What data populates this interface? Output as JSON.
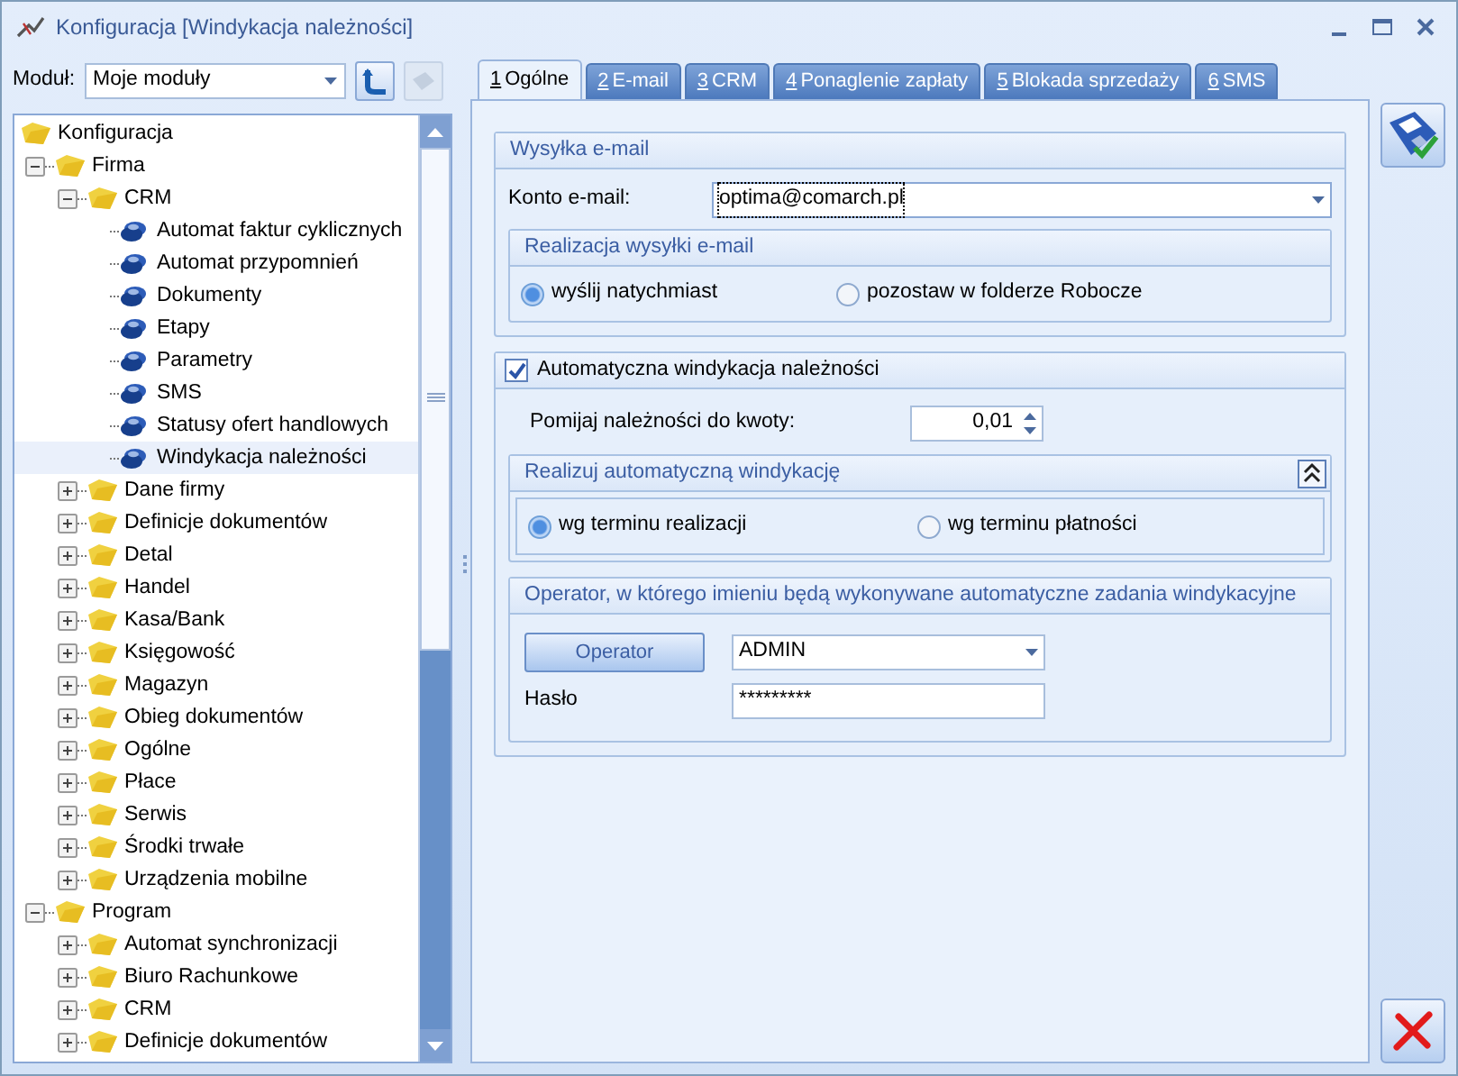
{
  "window": {
    "title": "Konfiguracja [Windykacja należności]"
  },
  "module": {
    "label": "Moduł:",
    "value": "Moje moduły"
  },
  "tree": [
    {
      "label": "Konfiguracja",
      "kind": "folder",
      "selected": false,
      "children": [
        {
          "label": "Firma",
          "kind": "folder",
          "selected": false,
          "expanded": true,
          "children": [
            {
              "label": "CRM",
              "kind": "folder",
              "selected": false,
              "expanded": true,
              "children": [
                {
                  "label": "Automat faktur cyklicznych",
                  "kind": "leaf",
                  "selected": false
                },
                {
                  "label": "Automat przypomnień",
                  "kind": "leaf",
                  "selected": false
                },
                {
                  "label": "Dokumenty",
                  "kind": "leaf",
                  "selected": false
                },
                {
                  "label": "Etapy",
                  "kind": "leaf",
                  "selected": false
                },
                {
                  "label": "Parametry",
                  "kind": "leaf",
                  "selected": false
                },
                {
                  "label": "SMS",
                  "kind": "leaf",
                  "selected": false
                },
                {
                  "label": "Statusy ofert handlowych",
                  "kind": "leaf",
                  "selected": false
                },
                {
                  "label": "Windykacja należności",
                  "kind": "leaf",
                  "selected": true
                }
              ]
            },
            {
              "label": "Dane firmy",
              "kind": "folder",
              "selected": false,
              "expanded": false
            },
            {
              "label": "Definicje dokumentów",
              "kind": "folder",
              "selected": false,
              "expanded": false
            },
            {
              "label": "Detal",
              "kind": "folder",
              "selected": false,
              "expanded": false
            },
            {
              "label": "Handel",
              "kind": "folder",
              "selected": false,
              "expanded": false
            },
            {
              "label": "Kasa/Bank",
              "kind": "folder",
              "selected": false,
              "expanded": false
            },
            {
              "label": "Księgowość",
              "kind": "folder",
              "selected": false,
              "expanded": false
            },
            {
              "label": "Magazyn",
              "kind": "folder",
              "selected": false,
              "expanded": false
            },
            {
              "label": "Obieg dokumentów",
              "kind": "folder",
              "selected": false,
              "expanded": false
            },
            {
              "label": "Ogólne",
              "kind": "folder",
              "selected": false,
              "expanded": false
            },
            {
              "label": "Płace",
              "kind": "folder",
              "selected": false,
              "expanded": false
            },
            {
              "label": "Serwis",
              "kind": "folder",
              "selected": false,
              "expanded": false
            },
            {
              "label": "Środki trwałe",
              "kind": "folder",
              "selected": false,
              "expanded": false
            },
            {
              "label": "Urządzenia mobilne",
              "kind": "folder",
              "selected": false,
              "expanded": false
            }
          ]
        },
        {
          "label": "Program",
          "kind": "folder",
          "selected": false,
          "expanded": true,
          "children": [
            {
              "label": "Automat synchronizacji",
              "kind": "folder",
              "selected": false,
              "expanded": false
            },
            {
              "label": "Biuro Rachunkowe",
              "kind": "folder",
              "selected": false,
              "expanded": false
            },
            {
              "label": "CRM",
              "kind": "folder",
              "selected": false,
              "expanded": false
            },
            {
              "label": "Definicje dokumentów",
              "kind": "folder",
              "selected": false,
              "expanded": false
            }
          ]
        }
      ]
    }
  ],
  "tabs": [
    {
      "hotkey": "1",
      "label": "Ogólne",
      "selected": true
    },
    {
      "hotkey": "2",
      "label": "E-mail",
      "selected": false
    },
    {
      "hotkey": "3",
      "label": "CRM",
      "selected": false
    },
    {
      "hotkey": "4",
      "label": "Ponaglenie zapłaty",
      "selected": false
    },
    {
      "hotkey": "5",
      "label": "Blokada sprzedaży",
      "selected": false
    },
    {
      "hotkey": "6",
      "label": "SMS",
      "selected": false
    }
  ],
  "email_section": {
    "title": "Wysyłka e-mail",
    "account_label": "Konto e-mail:",
    "account_value": "optima@comarch.pl",
    "sending": {
      "title": "Realizacja wysyłki e-mail",
      "options": [
        {
          "label": "wyślij natychmiast",
          "selected": true
        },
        {
          "label": "pozostaw w folderze Robocze",
          "selected": false
        }
      ]
    }
  },
  "auto_section": {
    "title": "Automatyczna windykacja należności",
    "checked": true,
    "threshold_label": "Pomijaj należności do kwoty:",
    "threshold_value": "0,01",
    "mode": {
      "title": "Realizuj automatyczną windykację",
      "expanded": true,
      "options": [
        {
          "label": "wg terminu realizacji",
          "selected": true
        },
        {
          "label": "wg terminu płatności",
          "selected": false
        }
      ]
    },
    "operator": {
      "title": "Operator, w którego imieniu będą wykonywane automatyczne zadania windykacyjne",
      "button": "Operator",
      "value": "ADMIN",
      "password_label": "Hasło",
      "password_value": "*********"
    }
  }
}
